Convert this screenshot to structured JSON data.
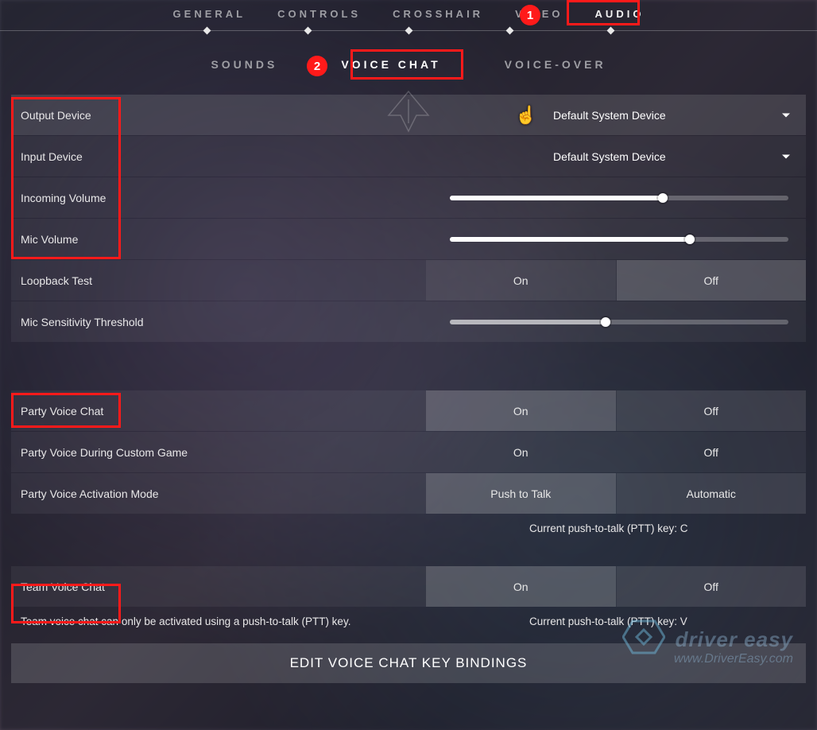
{
  "topnav": {
    "items": [
      "GENERAL",
      "CONTROLS",
      "CROSSHAIR",
      "VIDEO",
      "AUDIO"
    ],
    "active_index": 4
  },
  "subnav": {
    "items": [
      "SOUNDS",
      "VOICE CHAT",
      "VOICE-OVER"
    ],
    "active_index": 1
  },
  "rows": {
    "output_device": {
      "label": "Output Device",
      "value": "Default System Device"
    },
    "input_device": {
      "label": "Input Device",
      "value": "Default System Device"
    },
    "incoming_volume": {
      "label": "Incoming Volume",
      "percent": 63
    },
    "mic_volume": {
      "label": "Mic Volume",
      "percent": 71
    },
    "loopback_test": {
      "label": "Loopback Test",
      "options": [
        "On",
        "Off"
      ],
      "selected": 1
    },
    "mic_sens": {
      "label": "Mic Sensitivity Threshold",
      "percent": 46
    },
    "party_voice_chat": {
      "label": "Party Voice Chat",
      "options": [
        "On",
        "Off"
      ],
      "selected": 0
    },
    "party_voice_custom": {
      "label": "Party Voice During Custom Game",
      "options": [
        "On",
        "Off"
      ],
      "selected": null
    },
    "party_activation": {
      "label": "Party Voice Activation Mode",
      "options": [
        "Push to Talk",
        "Automatic"
      ],
      "selected": 0
    },
    "party_ptt_note": "Current push-to-talk (PTT) key: C",
    "team_voice_chat": {
      "label": "Team Voice Chat",
      "options": [
        "On",
        "Off"
      ],
      "selected": 0
    },
    "team_note_left": "Team voice chat can only be activated using a push-to-talk (PTT) key.",
    "team_note_right": "Current push-to-talk (PTT) key: V"
  },
  "edit_button": "EDIT VOICE CHAT KEY BINDINGS",
  "annotations": {
    "badge1": "1",
    "badge2": "2"
  },
  "watermark": {
    "line1": "driver easy",
    "line2": "www.DriverEasy.com"
  }
}
